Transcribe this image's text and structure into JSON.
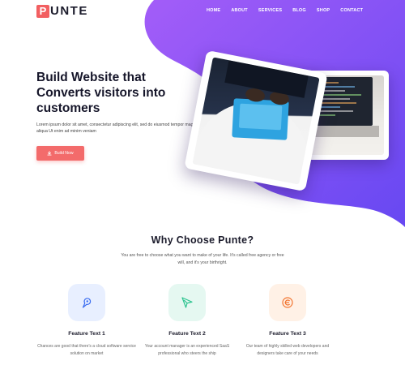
{
  "brand": {
    "logo_letter": "P",
    "logo_rest": "UNTE",
    "accent_color": "#f25f61"
  },
  "nav": {
    "items": [
      {
        "label": "HOME"
      },
      {
        "label": "ABOUT"
      },
      {
        "label": "SERVICES"
      },
      {
        "label": "BLOG"
      },
      {
        "label": "SHOP"
      },
      {
        "label": "CONTACT"
      }
    ]
  },
  "hero": {
    "title": "Build Website that Converts visitors into customers",
    "description": "Lorem ipsum dolor sit amet, consectetur adipiscing elit, sed do eiusmod tempor magna aliqua Ut enim ad minim veniam",
    "button_label": "Build Now",
    "button_icon": "download-icon",
    "background_colors": [
      "#a05cf7",
      "#6a4ef3"
    ]
  },
  "why": {
    "title": "Why Choose Punte?",
    "description": "You are free to choose what you want to make of your life. It's called free agency or free will, and it's your birthright."
  },
  "features": [
    {
      "icon": "pen-tool-icon",
      "icon_bg": "#e8efff",
      "icon_color": "#3b6df0",
      "title": "Feature Text 1",
      "description": "Chances are good that there's a cloud software service solution on market"
    },
    {
      "icon": "send-icon",
      "icon_bg": "#e5f8f1",
      "icon_color": "#2cc38f",
      "title": "Feature Text 2",
      "description": "Your account manager is an experienced SaaS professional who steers the ship"
    },
    {
      "icon": "logo-mark-icon",
      "icon_bg": "#fff1e6",
      "icon_color": "#f2742f",
      "title": "Feature Text 3",
      "description": "Our team of highly skilled web developers and designers take care of your needs"
    }
  ]
}
